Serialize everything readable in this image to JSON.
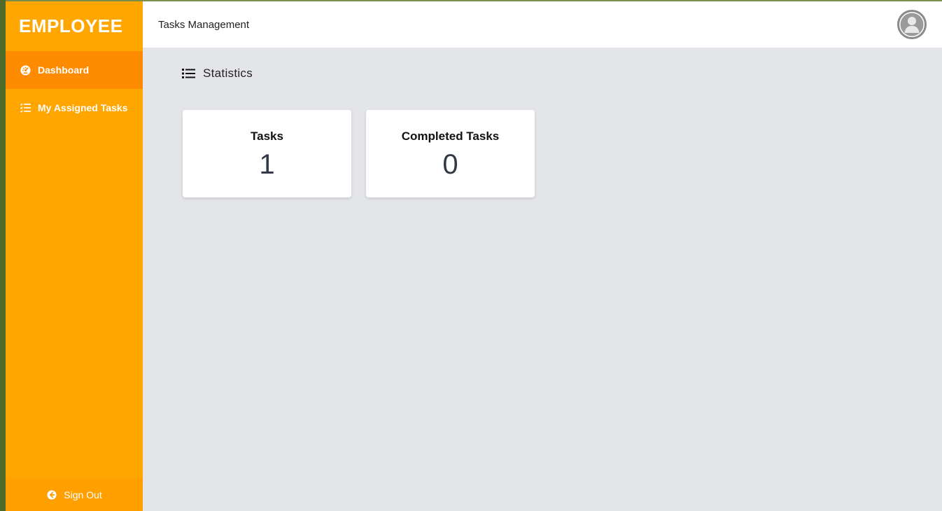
{
  "app": {
    "brand": "EMPLOYEE",
    "header_title": "Tasks Management"
  },
  "sidebar": {
    "items": [
      {
        "label": "Dashboard",
        "icon": "dashboard-gauge-icon",
        "active": true
      },
      {
        "label": "My Assigned Tasks",
        "icon": "task-list-icon",
        "active": false
      }
    ],
    "signout_label": "Sign Out",
    "signout_icon": "arrow-circle-left-icon"
  },
  "main": {
    "section_title": "Statistics",
    "section_icon": "list-icon",
    "cards": [
      {
        "title": "Tasks",
        "value": "1"
      },
      {
        "title": "Completed Tasks",
        "value": "0"
      }
    ]
  },
  "colors": {
    "sidebar": "#ffa600",
    "sidebar_active": "#ff8c00",
    "main_bg": "#e4e5e9",
    "card_bg": "#ffffff"
  },
  "avatar_icon": "user-avatar-icon"
}
